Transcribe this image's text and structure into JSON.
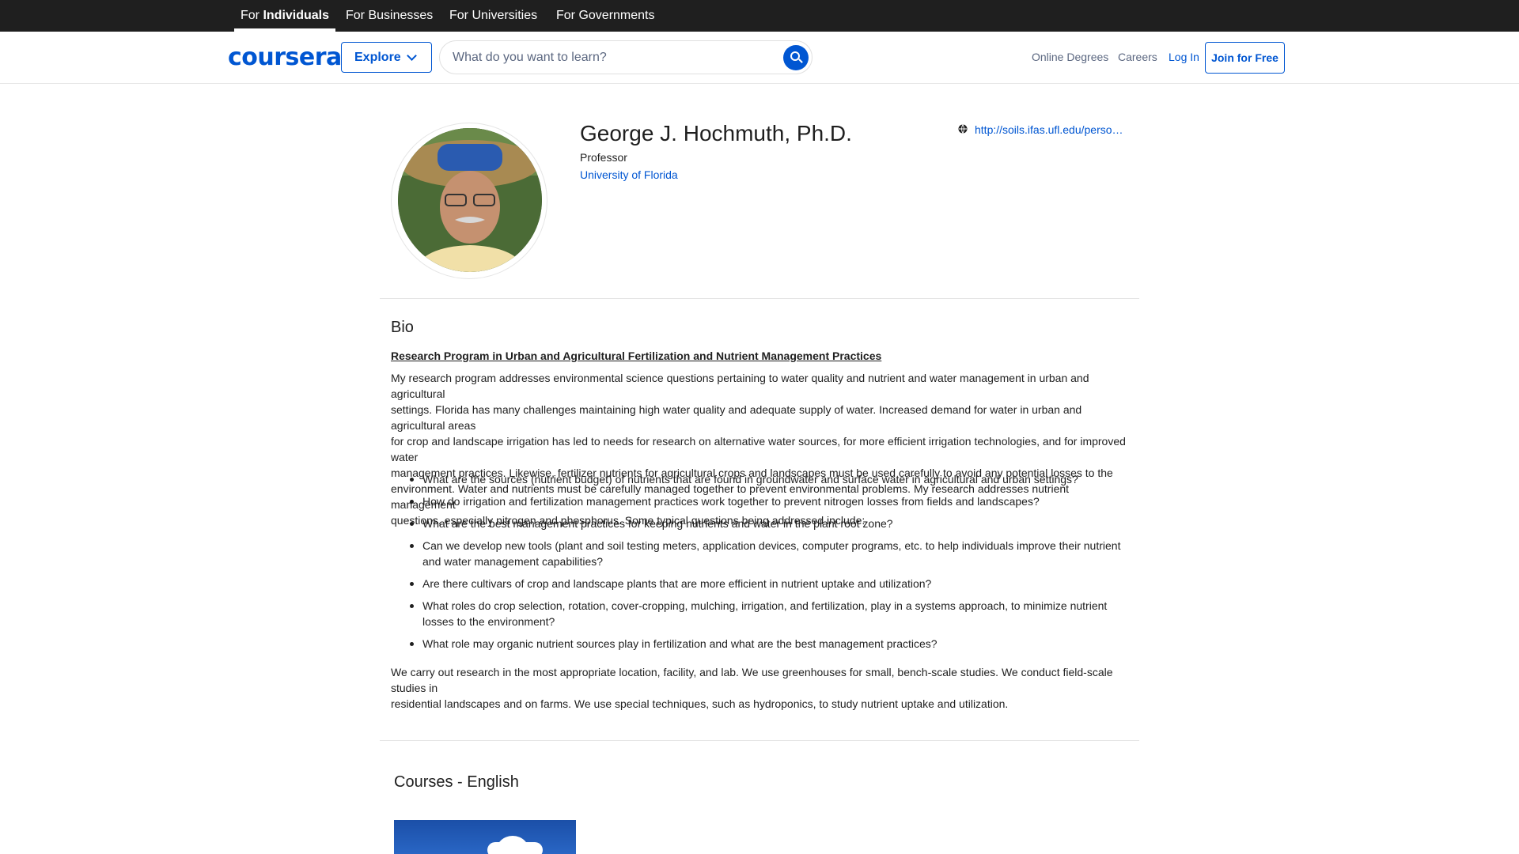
{
  "audience_tabs": [
    {
      "prefix": "For ",
      "bold": "Individuals"
    },
    {
      "label": "For Businesses"
    },
    {
      "label": "For Universities"
    },
    {
      "label": "For Governments"
    }
  ],
  "header": {
    "logo_text": "coursera",
    "explore_label": "Explore",
    "search_placeholder": "What do you want to learn?",
    "links": {
      "online_degrees": "Online Degrees",
      "careers": "Careers",
      "login": "Log In",
      "join": "Join for Free"
    }
  },
  "profile": {
    "name": "George J. Hochmuth, Ph.D.",
    "title": "Professor",
    "organization": "University of Florida",
    "website": "http://soils.ifas.ufl.edu/person..."
  },
  "bio": {
    "heading": "Bio",
    "subheading": "Research Program in Urban and Agricultural Fertilization and Nutrient Management Practices",
    "intro_lines": [
      "My research program addresses environmental science questions pertaining to water quality and nutrient and water management in urban and agricultural",
      "settings. Florida has many challenges maintaining high water quality and adequate supply of water. Increased demand for water in urban and agricultural areas",
      "for crop and landscape irrigation has led to needs for research on alternative water sources, for more efficient irrigation technologies, and for improved water",
      "management practices. Likewise, fertilizer nutrients for agricultural crops and landscapes must be used carefully to avoid any potential losses to the",
      "environment. Water and nutrients must be carefully managed together to prevent environmental problems. My research addresses nutrient management",
      "questions, especially nitrogen and phosphorus. Some typical questions being addressed include:"
    ],
    "questions": [
      "What are the sources (nutrient budget) of nutrients that are found in groundwater and surface water in agricultural and urban settings?",
      "How do irrigation and fertilization management practices work together to prevent nitrogen losses from fields and landscapes?",
      "What are the best management practices for keeping nutrients and water in the plant root zone?",
      "Can we develop new tools (plant and soil testing meters, application devices, computer programs, etc. to help individuals improve their nutrient and water management capabilities?",
      "Are there cultivars of crop and landscape plants that are more efficient in nutrient uptake and utilization?",
      "What roles do crop selection, rotation, cover-cropping, mulching, irrigation, and fertilization, play in a systems approach, to minimize nutrient losses to the environment?",
      "What role may organic nutrient sources play in fertilization and what are the best management practices?"
    ],
    "closing_lines": [
      "We carry out research in the most appropriate location, facility, and lab. We use greenhouses for small, bench-scale studies. We conduct field-scale studies in",
      "residential landscapes and on farms. We use special techniques, such as hydroponics, to study nutrient uptake and utilization."
    ]
  },
  "courses": {
    "heading": "Courses - English"
  },
  "colors": {
    "brand_blue": "#0056d2",
    "topbar_bg": "#1f1f1f",
    "text": "#1f1f1f",
    "muted": "#5b6780"
  }
}
